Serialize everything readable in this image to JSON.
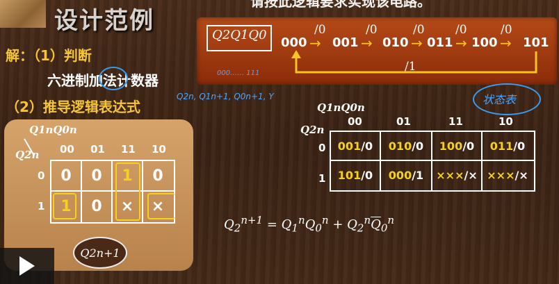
{
  "header": {
    "title": "设计范例",
    "top_text": "请按此逻辑要求实现该电路。"
  },
  "solution": {
    "solve_label": "解：（1）判断",
    "counter_type": "六进制加法计数器",
    "step2": "（2）推导逻辑表达式"
  },
  "state_diagram": {
    "label": "Q2Q1Q0",
    "states": [
      "000",
      "001",
      "010",
      "011",
      "100",
      "101"
    ],
    "transition_outputs": [
      "/0",
      "/0",
      "/0",
      "/0",
      "/0"
    ],
    "return_output": "/1"
  },
  "kmap_left": {
    "row_var": "Q2n",
    "col_var": "Q1nQ0n",
    "col_headers": [
      "00",
      "01",
      "11",
      "10"
    ],
    "row_headers": [
      "0",
      "1"
    ],
    "cells": [
      [
        "0",
        "0",
        "1",
        "0"
      ],
      [
        "1",
        "0",
        "×",
        "×"
      ]
    ],
    "output_label": "Q2n+1"
  },
  "kmap_right": {
    "row_var": "Q2n",
    "col_var": "Q1nQ0n",
    "col_headers": [
      "00",
      "01",
      "11",
      "10"
    ],
    "row_headers": [
      "0",
      "1"
    ],
    "cells": [
      [
        {
          "state": "001",
          "out": "/0"
        },
        {
          "state": "010",
          "out": "/0"
        },
        {
          "state": "100",
          "out": "/0"
        },
        {
          "state": "011",
          "out": "/0"
        }
      ],
      [
        {
          "state": "101",
          "out": "/0"
        },
        {
          "state": "000",
          "out": "/1"
        },
        {
          "state": "×××",
          "out": "/×"
        },
        {
          "state": "×××",
          "out": "/×"
        }
      ]
    ]
  },
  "handwritten": {
    "note1": "000…… 111",
    "note2": "Q2n, Q1n+1, Q0n+1, Y",
    "note3": "状态表"
  },
  "colors": {
    "accent_yellow": "#f5d020",
    "title_gold": "#f5c43a",
    "diagram_bg": "#a63d12",
    "annotation_blue": "#3a9cf0"
  },
  "controls": {
    "play_icon": "play-icon"
  }
}
